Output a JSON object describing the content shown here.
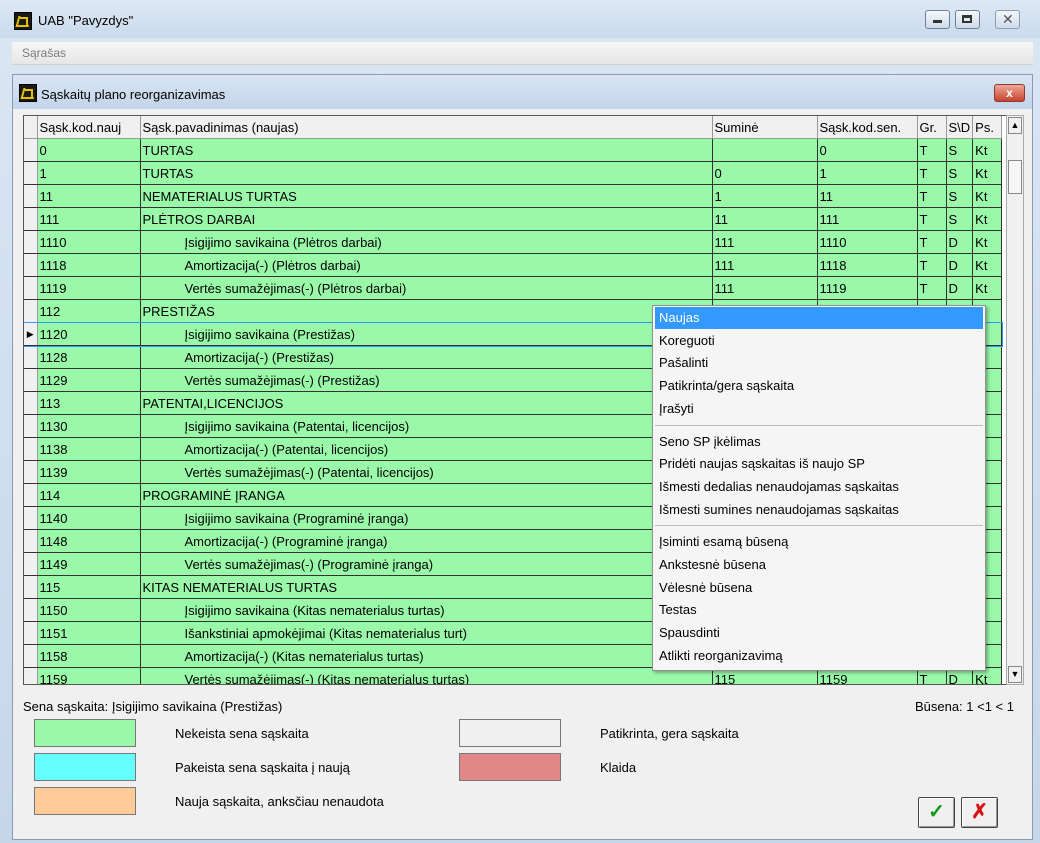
{
  "window": {
    "title": "UAB \"Pavyzdys\""
  },
  "menu": {
    "items": [
      "Sąrašas"
    ]
  },
  "dialog": {
    "title": "Sąskaitų plano reorganizavimas"
  },
  "table": {
    "columns": [
      "Sąsk.kod.nauj",
      "Sąsk.pavadinimas (naujas)",
      "Suminė",
      "Sąsk.kod.sen.",
      "Gr.",
      "S\\D",
      "Ps."
    ],
    "rows": [
      {
        "code": "0",
        "name": "TURTAS",
        "sum": "",
        "old": "0",
        "gr": "T",
        "sd": "S",
        "ps": "Kt",
        "indent": false
      },
      {
        "code": "1",
        "name": "TURTAS",
        "sum": "0",
        "old": "1",
        "gr": "T",
        "sd": "S",
        "ps": "Kt",
        "indent": false
      },
      {
        "code": "11",
        "name": "NEMATERIALUS TURTAS",
        "sum": "1",
        "old": "11",
        "gr": "T",
        "sd": "S",
        "ps": "Kt",
        "indent": false
      },
      {
        "code": "111",
        "name": "PLĖTROS DARBAI",
        "sum": "11",
        "old": "111",
        "gr": "T",
        "sd": "S",
        "ps": "Kt",
        "indent": false
      },
      {
        "code": "1110",
        "name": "Įsigijimo savikaina (Plėtros darbai)",
        "sum": "111",
        "old": "1110",
        "gr": "T",
        "sd": "D",
        "ps": "Kt",
        "indent": true
      },
      {
        "code": "1118",
        "name": "Amortizacija(-) (Plėtros darbai)",
        "sum": "111",
        "old": "1118",
        "gr": "T",
        "sd": "D",
        "ps": "Kt",
        "indent": true
      },
      {
        "code": "1119",
        "name": "Vertės sumažėjimas(-) (Plėtros darbai)",
        "sum": "111",
        "old": "1119",
        "gr": "T",
        "sd": "D",
        "ps": "Kt",
        "indent": true
      },
      {
        "code": "112",
        "name": "PRESTIŽAS",
        "sum": "",
        "old": "",
        "gr": "",
        "sd": "",
        "ps": "t",
        "indent": false
      },
      {
        "code": "1120",
        "name": "Įsigijimo savikaina (Prestižas)",
        "sum": "",
        "old": "",
        "gr": "",
        "sd": "",
        "ps": "t",
        "indent": true
      },
      {
        "code": "1128",
        "name": "Amortizacija(-) (Prestižas)",
        "sum": "",
        "old": "",
        "gr": "",
        "sd": "",
        "ps": "t",
        "indent": true
      },
      {
        "code": "1129",
        "name": "Vertės sumažėjimas(-) (Prestižas)",
        "sum": "",
        "old": "",
        "gr": "",
        "sd": "",
        "ps": "t",
        "indent": true
      },
      {
        "code": "113",
        "name": "PATENTAI,LICENCIJOS",
        "sum": "",
        "old": "",
        "gr": "",
        "sd": "",
        "ps": "t",
        "indent": false
      },
      {
        "code": "1130",
        "name": "Įsigijimo savikaina (Patentai, licencijos)",
        "sum": "",
        "old": "",
        "gr": "",
        "sd": "",
        "ps": "t",
        "indent": true
      },
      {
        "code": "1138",
        "name": "Amortizacija(-) (Patentai, licencijos)",
        "sum": "",
        "old": "",
        "gr": "",
        "sd": "",
        "ps": "t",
        "indent": true
      },
      {
        "code": "1139",
        "name": "Vertės sumažėjimas(-) (Patentai, licencijos)",
        "sum": "",
        "old": "",
        "gr": "",
        "sd": "",
        "ps": "t",
        "indent": true
      },
      {
        "code": "114",
        "name": "PROGRAMINĖ ĮRANGA",
        "sum": "",
        "old": "",
        "gr": "",
        "sd": "",
        "ps": "t",
        "indent": false
      },
      {
        "code": "1140",
        "name": "Įsigijimo savikaina (Programinė įranga)",
        "sum": "",
        "old": "",
        "gr": "",
        "sd": "",
        "ps": "t",
        "indent": true
      },
      {
        "code": "1148",
        "name": "Amortizacija(-) (Programinė įranga)",
        "sum": "",
        "old": "",
        "gr": "",
        "sd": "",
        "ps": "t",
        "indent": true
      },
      {
        "code": "1149",
        "name": "Vertės sumažėjimas(-) (Programinė įranga)",
        "sum": "",
        "old": "",
        "gr": "",
        "sd": "",
        "ps": "t",
        "indent": true
      },
      {
        "code": "115",
        "name": "KITAS NEMATERIALUS TURTAS",
        "sum": "",
        "old": "",
        "gr": "",
        "sd": "",
        "ps": "t",
        "indent": false
      },
      {
        "code": "1150",
        "name": "Įsigijimo savikaina (Kitas nematerialus turtas)",
        "sum": "",
        "old": "",
        "gr": "",
        "sd": "",
        "ps": "t",
        "indent": true
      },
      {
        "code": "1151",
        "name": "Išankstiniai apmokėjimai (Kitas nematerialus turt)",
        "sum": "",
        "old": "",
        "gr": "",
        "sd": "",
        "ps": "t",
        "indent": true
      },
      {
        "code": "1158",
        "name": "Amortizacija(-) (Kitas nematerialus turtas)",
        "sum": "",
        "old": "",
        "gr": "",
        "sd": "",
        "ps": "t",
        "indent": true
      },
      {
        "code": "1159",
        "name": "Vertės sumažėjimas(-) (Kitas nematerialus turtas)",
        "sum": "115",
        "old": "1159",
        "gr": "T",
        "sd": "D",
        "ps": "Kt",
        "indent": true
      }
    ],
    "current_row_marker": "▶"
  },
  "context_menu": {
    "groups": [
      [
        "Naujas",
        "Koreguoti",
        "Pašalinti",
        "Patikrinta/gera sąskaita",
        "Įrašyti"
      ],
      [
        "Seno SP įkėlimas",
        "Pridėti naujas sąskaitas iš naujo SP",
        "Išmesti dedalias nenaudojamas sąskaitas",
        "Išmesti sumines nenaudojamas sąskaitas"
      ],
      [
        "Įsiminti esamą būseną",
        "Ankstesnė būsena",
        "Vėlesnė būsena",
        "Testas",
        "Spausdinti",
        "Atlikti reorganizavimą"
      ]
    ],
    "highlighted": "Naujas"
  },
  "status": {
    "old_account": "Sena sąskaita: Įsigijimo savikaina (Prestižas)",
    "state": "Būsena: 1 <1 < 1"
  },
  "legend": [
    {
      "color": "#99f9a8",
      "label": "Nekeista sena sąskaita"
    },
    {
      "color": "#66ffff",
      "label": "Pakeista sena sąskaita į naują"
    },
    {
      "color": "#ffcc99",
      "label": "Nauja sąskaita, anksčiau nenaudota"
    },
    {
      "color": "#f0f0f0",
      "label": "Patikrinta, gera sąskaita"
    },
    {
      "color": "#e08888",
      "label": "Klaida"
    }
  ],
  "buttons": {
    "ok": "✓",
    "cancel": "✗",
    "close": "x"
  },
  "colors": {
    "row_green": "#99f9a8",
    "highlight": "#3399ff"
  }
}
